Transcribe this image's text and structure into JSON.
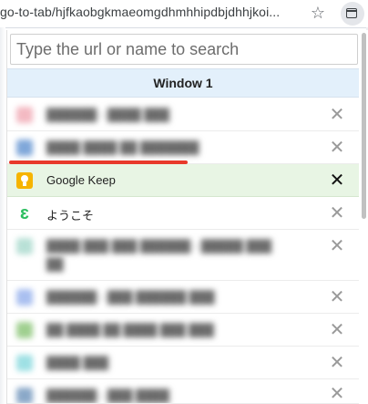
{
  "browser": {
    "url_text": "go-to-tab/hjfkaobgkmaeomgdhmhhipdbjdhhjkoi...",
    "star_icon": "star-icon",
    "extension_icon": "window-icon"
  },
  "popup": {
    "search": {
      "value": "",
      "placeholder": "Type the url or name to search"
    },
    "window_header": "Window 1",
    "tabs": [
      {
        "title": "██████ - ████ ███",
        "favicon_color": "#f3b9c2",
        "blurred": true
      },
      {
        "title": "████ ████ ██ ███████",
        "favicon_color": "#7fa7d9",
        "blurred": true
      },
      {
        "title": "Google Keep",
        "favicon_color": "#f6b400",
        "icon": "google-keep-icon",
        "blurred": false,
        "selected": true
      },
      {
        "title": "ようこそ",
        "favicon_color": "#2dbe60",
        "icon": "evernote-icon",
        "blurred": false
      },
      {
        "title": "████ ███ ███ ██████ - █████ ███",
        "title_line2": "██",
        "favicon_color": "#b8e0d6",
        "blurred": true
      },
      {
        "title": "██████ - ███ ██████ ███",
        "favicon_color": "#a9bff0",
        "blurred": true
      },
      {
        "title": "██ ████ ██ ████ ███ ███",
        "favicon_color": "#9fcf8f",
        "blurred": true
      },
      {
        "title": "████ ███",
        "favicon_color": "#9ee0e4",
        "blurred": true
      },
      {
        "title": "██████ - ███ ████",
        "favicon_color": "#8aa8c8",
        "blurred": true
      }
    ],
    "close_glyph": "✕",
    "accent_underline_color": "#e8392b"
  }
}
